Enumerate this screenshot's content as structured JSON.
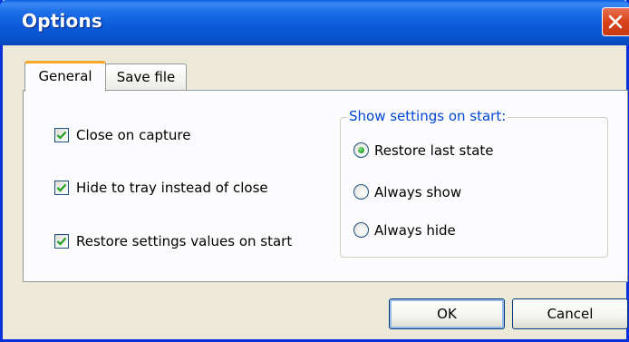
{
  "window": {
    "title": "Options"
  },
  "tabs": [
    {
      "label": "General",
      "selected": true
    },
    {
      "label": "Save file",
      "selected": false
    }
  ],
  "general": {
    "checkboxes": [
      {
        "label": "Close on capture",
        "checked": true
      },
      {
        "label": "Hide to tray instead of close",
        "checked": true
      },
      {
        "label": "Restore settings values on start",
        "checked": true
      }
    ],
    "show_settings_group": {
      "title": "Show settings on start:",
      "options": [
        {
          "label": "Restore last state",
          "selected": true
        },
        {
          "label": "Always show",
          "selected": false
        },
        {
          "label": "Always hide",
          "selected": false
        }
      ]
    }
  },
  "buttons": {
    "ok_label": "OK",
    "cancel_label": "Cancel"
  },
  "icons": {
    "close": "close-icon",
    "check": "checkmark-icon"
  },
  "colors": {
    "titlebar": "#0a54d0",
    "face": "#ece9d8",
    "group_title": "#0046d5",
    "check": "#21a121",
    "close_button": "#d8431a",
    "active_tab_accent": "#f7a827"
  }
}
